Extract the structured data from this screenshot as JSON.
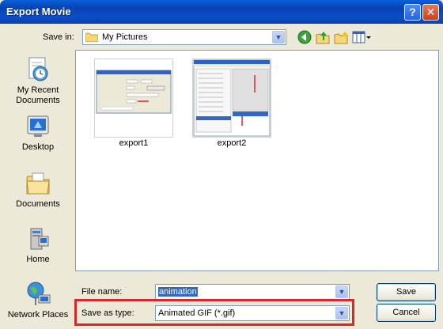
{
  "window": {
    "title": "Export Movie"
  },
  "titlebar": {
    "help_label": "?",
    "close_label": "✕"
  },
  "savein": {
    "label": "Save in:",
    "value": "My Pictures"
  },
  "toolbar": {
    "icons": [
      "back-icon",
      "up-folder-icon",
      "new-folder-icon",
      "views-menu-icon"
    ]
  },
  "places": [
    {
      "label": "My Recent Documents",
      "icon": "recent-documents-icon"
    },
    {
      "label": "Desktop",
      "icon": "desktop-icon"
    },
    {
      "label": "Documents",
      "icon": "documents-icon"
    },
    {
      "label": "Home",
      "icon": "home-icon"
    },
    {
      "label": "Network Places",
      "icon": "network-places-icon"
    }
  ],
  "files": [
    {
      "name": "export1"
    },
    {
      "name": "export2"
    }
  ],
  "filename": {
    "label": "File name:",
    "value": "animation"
  },
  "filetype": {
    "label": "Save as type:",
    "value": "Animated GIF (*.gif)"
  },
  "buttons": {
    "save": "Save",
    "cancel": "Cancel"
  },
  "colors": {
    "titlebar": "#0a4fc8",
    "highlight": "#d42a2a",
    "selection": "#316ac5"
  }
}
